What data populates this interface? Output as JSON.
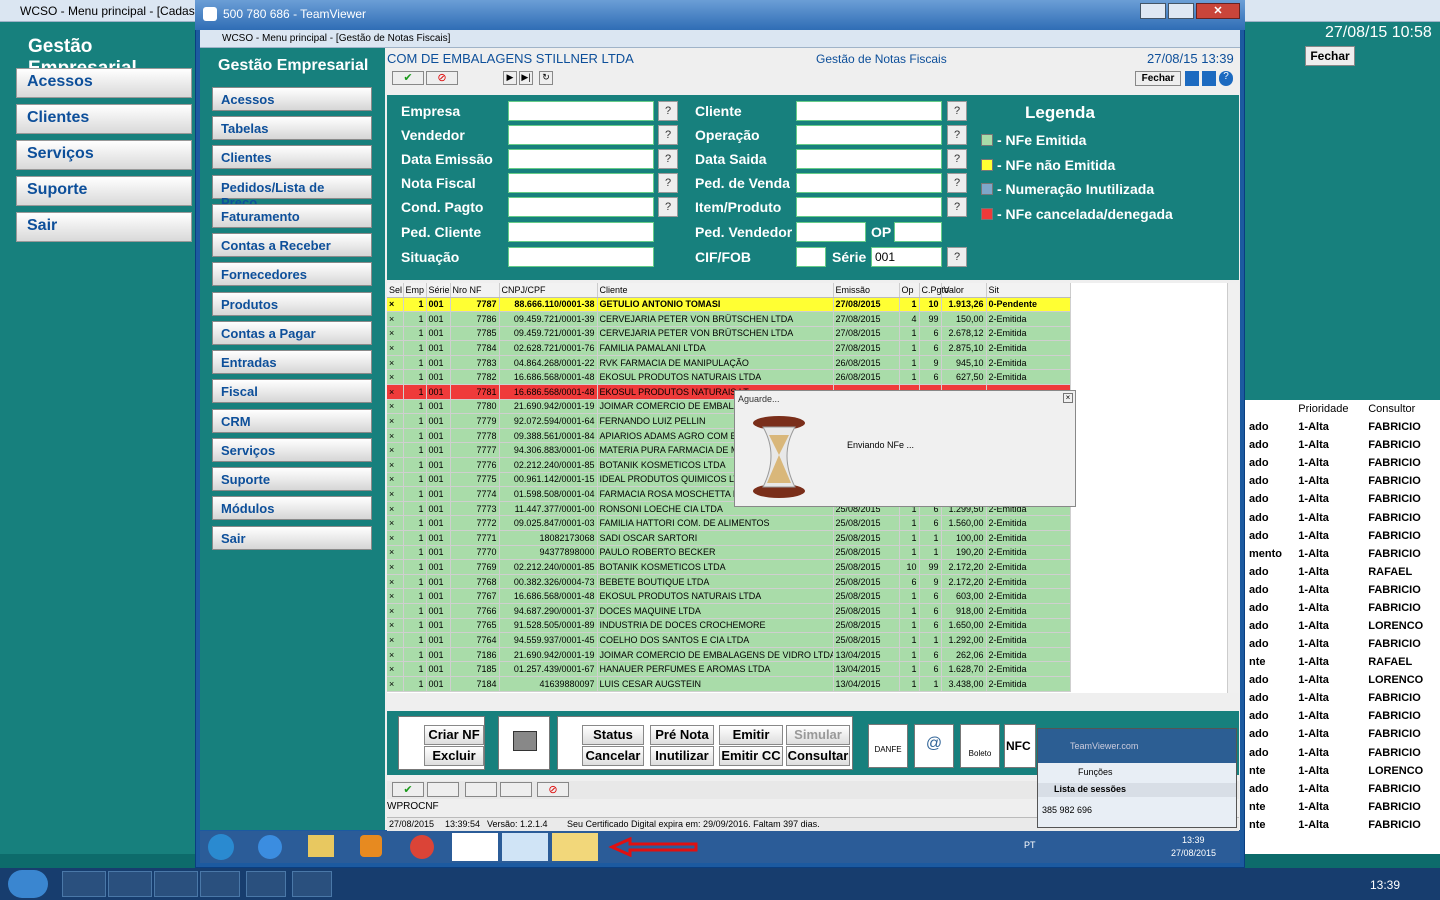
{
  "outer_window": {
    "title": "WCSO - Menu principal - [Cadas",
    "header": "Gestão Empresarial",
    "menu": [
      "Acessos",
      "Clientes",
      "Serviços",
      "Suporte",
      "Sair"
    ],
    "right_date": "27/08/15 10:58",
    "right_close": "Fechar"
  },
  "teamviewer": {
    "title": "500 780 686 - TeamViewer"
  },
  "inner_window": {
    "title": "WCSO - Menu principal - [Gestão de Notas Fiscais]",
    "company": "COM DE EMBALAGENS STILLNER LTDA",
    "screen": "Gestão de Notas Fiscais",
    "datetime": "27/08/15 13:39",
    "close": "Fechar",
    "sidebar_header": "Gestão Empresarial",
    "sidebar": [
      "Acessos",
      "Tabelas",
      "Clientes",
      "Pedidos/Lista de Preço",
      "Faturamento",
      "Contas a Receber",
      "Fornecedores",
      "Produtos",
      "Contas a Pagar",
      "Entradas",
      "Fiscal",
      "CRM",
      "Serviços",
      "Suporte",
      "Módulos",
      "Sair"
    ]
  },
  "filters": {
    "empresa": "Empresa",
    "vendedor": "Vendedor",
    "data_emissao": "Data Emissão",
    "nota_fiscal": "Nota Fiscal",
    "cond_pagto": "Cond. Pagto",
    "ped_cliente": "Ped. Cliente",
    "situacao": "Situação",
    "cliente": "Cliente",
    "operacao": "Operação",
    "data_saida": "Data Saida",
    "ped_venda": "Ped. de Venda",
    "item_produto": "Item/Produto",
    "ped_vendedor": "Ped. Vendedor",
    "op": "OP",
    "cif_fob": "CIF/FOB",
    "serie": "Série",
    "serie_value": "001"
  },
  "legend": {
    "title": "Legenda",
    "items": [
      {
        "label": "- NFe Emitida",
        "color": "#a9dca9"
      },
      {
        "label": "- NFe não Emitida",
        "color": "#ffff33"
      },
      {
        "label": "- Numeração Inutilizada",
        "color": "#7fa7c9"
      },
      {
        "label": "- NFe cancelada/denegada",
        "color": "#ef3a3a"
      }
    ]
  },
  "grid": {
    "columns": [
      "Sel",
      "Emp",
      "Série",
      "Nro NF",
      "CNPJ/CPF",
      "Cliente",
      "Emissão",
      "Op",
      "C.Pgto",
      "Valor",
      "Sit"
    ],
    "rows": [
      [
        "×",
        "1",
        "001",
        "7787",
        "88.666.110/0001-38",
        "GETULIO ANTONIO TOMASI",
        "27/08/2015",
        "1",
        "10",
        "1.913,26",
        "0-Pendente",
        "y"
      ],
      [
        "×",
        "1",
        "001",
        "7786",
        "09.459.721/0001-39",
        "CERVEJARIA PETER VON BRÜTSCHEN LTDA",
        "27/08/2015",
        "4",
        "99",
        "150,00",
        "2-Emitida",
        "g"
      ],
      [
        "×",
        "1",
        "001",
        "7785",
        "09.459.721/0001-39",
        "CERVEJARIA PETER VON BRÜTSCHEN LTDA",
        "27/08/2015",
        "1",
        "6",
        "2.678,12",
        "2-Emitida",
        "g"
      ],
      [
        "×",
        "1",
        "001",
        "7784",
        "02.628.721/0001-76",
        "FAMILIA PAMALANI LTDA",
        "27/08/2015",
        "1",
        "6",
        "2.875,10",
        "2-Emitida",
        "g"
      ],
      [
        "×",
        "1",
        "001",
        "7783",
        "04.864.268/0001-22",
        "RVK FARMACIA DE MANIPULAÇÃO",
        "26/08/2015",
        "1",
        "9",
        "945,10",
        "2-Emitida",
        "g"
      ],
      [
        "×",
        "1",
        "001",
        "7782",
        "16.686.568/0001-48",
        "EKOSUL PRODUTOS NATURAIS LTDA",
        "26/08/2015",
        "1",
        "6",
        "627,50",
        "2-Emitida",
        "g"
      ],
      [
        "×",
        "1",
        "001",
        "7781",
        "16.686.568/0001-48",
        "EKOSUL PRODUTOS NATURAIS LT",
        "",
        "",
        "",
        "",
        "",
        "r"
      ],
      [
        "×",
        "1",
        "001",
        "7780",
        "21.690.942/0001-19",
        "JOIMAR COMERCIO DE EMBALAGE",
        "",
        "",
        "",
        "",
        "",
        "g"
      ],
      [
        "×",
        "1",
        "001",
        "7779",
        "92.072.594/0001-64",
        "FERNANDO LUIZ PELLIN",
        "",
        "",
        "",
        "",
        "",
        "g"
      ],
      [
        "×",
        "1",
        "001",
        "7778",
        "09.388.561/0001-84",
        "APIARIOS ADAMS AGRO COM EXP",
        "",
        "",
        "",
        "",
        "",
        "g"
      ],
      [
        "×",
        "1",
        "001",
        "7777",
        "94.306.883/0001-06",
        "MATERIA PURA FARMACIA DE MA",
        "",
        "",
        "",
        "",
        "",
        "g"
      ],
      [
        "×",
        "1",
        "001",
        "7776",
        "02.212.240/0001-85",
        "BOTANIK KOSMETICOS LTDA",
        "",
        "",
        "",
        "",
        "",
        "g"
      ],
      [
        "×",
        "1",
        "001",
        "7775",
        "00.961.142/0001-15",
        "IDEAL PRODUTOS QUIMICOS LTDA",
        "",
        "",
        "",
        "",
        "",
        "g"
      ],
      [
        "×",
        "1",
        "001",
        "7774",
        "01.598.508/0001-04",
        "FARMACIA ROSA MOSCHETTA LTD",
        "",
        "",
        "",
        "",
        "",
        "g"
      ],
      [
        "×",
        "1",
        "001",
        "7773",
        "11.447.377/0001-00",
        "RONSONI LOECHE CIA LTDA",
        "25/08/2015",
        "1",
        "6",
        "1.299,50",
        "2-Emitida",
        "g"
      ],
      [
        "×",
        "1",
        "001",
        "7772",
        "09.025.847/0001-03",
        "FAMILIA HATTORI COM. DE ALIMENTOS",
        "25/08/2015",
        "1",
        "6",
        "1.560,00",
        "2-Emitida",
        "g"
      ],
      [
        "×",
        "1",
        "001",
        "7771",
        "18082173068",
        "SADI OSCAR SARTORI",
        "25/08/2015",
        "1",
        "1",
        "100,00",
        "2-Emitida",
        "g"
      ],
      [
        "×",
        "1",
        "001",
        "7770",
        "94377898000",
        "PAULO ROBERTO BECKER",
        "25/08/2015",
        "1",
        "1",
        "190,20",
        "2-Emitida",
        "g"
      ],
      [
        "×",
        "1",
        "001",
        "7769",
        "02.212.240/0001-85",
        "BOTANIK KOSMETICOS LTDA",
        "25/08/2015",
        "10",
        "99",
        "2.172,20",
        "2-Emitida",
        "g"
      ],
      [
        "×",
        "1",
        "001",
        "7768",
        "00.382.326/0004-73",
        "BEBETE BOUTIQUE LTDA",
        "25/08/2015",
        "6",
        "9",
        "2.172,20",
        "2-Emitida",
        "g"
      ],
      [
        "×",
        "1",
        "001",
        "7767",
        "16.686.568/0001-48",
        "EKOSUL PRODUTOS NATURAIS LTDA",
        "25/08/2015",
        "1",
        "6",
        "603,00",
        "2-Emitida",
        "g"
      ],
      [
        "×",
        "1",
        "001",
        "7766",
        "94.687.290/0001-37",
        "DOCES MAQUINE LTDA",
        "25/08/2015",
        "1",
        "6",
        "918,00",
        "2-Emitida",
        "g"
      ],
      [
        "×",
        "1",
        "001",
        "7765",
        "91.528.505/0001-89",
        "INDUSTRIA DE DOCES CROCHEMORE",
        "25/08/2015",
        "1",
        "6",
        "1.650,00",
        "2-Emitida",
        "g"
      ],
      [
        "×",
        "1",
        "001",
        "7764",
        "94.559.937/0001-45",
        "COELHO DOS SANTOS E CIA LTDA",
        "25/08/2015",
        "1",
        "1",
        "1.292,00",
        "2-Emitida",
        "g"
      ],
      [
        "×",
        "1",
        "001",
        "7186",
        "21.690.942/0001-19",
        "JOIMAR COMERCIO DE EMBALAGENS DE VIDRO LTDA ME",
        "13/04/2015",
        "1",
        "6",
        "262,06",
        "2-Emitida",
        "g"
      ],
      [
        "×",
        "1",
        "001",
        "7185",
        "01.257.439/0001-67",
        "HANAUER PERFUMES E AROMAS LTDA",
        "13/04/2015",
        "1",
        "6",
        "1.628,70",
        "2-Emitida",
        "g"
      ],
      [
        "×",
        "1",
        "001",
        "7184",
        "41639880097",
        "LUIS CESAR AUGSTEIN",
        "13/04/2015",
        "1",
        "1",
        "3.438,00",
        "2-Emitida",
        "g"
      ]
    ]
  },
  "dialog": {
    "title": "Aguarde...",
    "message": "Enviando NFe ..."
  },
  "actions": {
    "criar_nf": "Criar NF",
    "excluir": "Excluir",
    "status": "Status",
    "pre_nota": "Pré Nota",
    "emitir": "Emitir",
    "simular": "Simular",
    "cancelar": "Cancelar",
    "inutilizar": "Inutilizar",
    "emitir_cc": "Emitir CC",
    "consultar": "Consultar",
    "nfc": "NFC",
    "danfe": "DANFE",
    "boleto": "Boleto"
  },
  "status_bar": {
    "proc": "WPROCNF",
    "date": "27/08/2015",
    "time": "13:39:54",
    "version": "Versão: 1.2.1.4",
    "cert": "Seu Certificado Digital expira em: 29/09/2016. Faltam 397 dias."
  },
  "inner_taskbar": {
    "lang": "PT",
    "time": "13:39",
    "date": "27/08/2015"
  },
  "tv_panel": {
    "site": "TeamViewer.com",
    "funcoes": "Funções",
    "sessions": "Lista de sessões",
    "session_id": "385 982 696"
  },
  "right_list": {
    "columns": [
      "Prioridade",
      "Consultor"
    ],
    "rows": [
      [
        "ado",
        "1-Alta",
        "FABRICIO"
      ],
      [
        "ado",
        "1-Alta",
        "FABRICIO"
      ],
      [
        "ado",
        "1-Alta",
        "FABRICIO"
      ],
      [
        "ado",
        "1-Alta",
        "FABRICIO"
      ],
      [
        "ado",
        "1-Alta",
        "FABRICIO"
      ],
      [
        "ado",
        "1-Alta",
        "FABRICIO"
      ],
      [
        "ado",
        "1-Alta",
        "FABRICIO"
      ],
      [
        "mento",
        "1-Alta",
        "FABRICIO"
      ],
      [
        "ado",
        "1-Alta",
        "RAFAEL"
      ],
      [
        "ado",
        "1-Alta",
        "FABRICIO"
      ],
      [
        "ado",
        "1-Alta",
        "FABRICIO"
      ],
      [
        "ado",
        "1-Alta",
        "LORENCO"
      ],
      [
        "ado",
        "1-Alta",
        "FABRICIO"
      ],
      [
        "nte",
        "1-Alta",
        "RAFAEL"
      ],
      [
        "ado",
        "1-Alta",
        "LORENCO"
      ],
      [
        "ado",
        "1-Alta",
        "FABRICIO"
      ],
      [
        "ado",
        "1-Alta",
        "FABRICIO"
      ],
      [
        "ado",
        "1-Alta",
        "FABRICIO"
      ],
      [
        "ado",
        "1-Alta",
        "FABRICIO"
      ],
      [
        "nte",
        "1-Alta",
        "LORENCO"
      ],
      [
        "ado",
        "1-Alta",
        "FABRICIO"
      ],
      [
        "nte",
        "1-Alta",
        "FABRICIO"
      ],
      [
        "nte",
        "1-Alta",
        "FABRICIO"
      ]
    ]
  },
  "main_taskbar": {
    "time": "13:39"
  }
}
